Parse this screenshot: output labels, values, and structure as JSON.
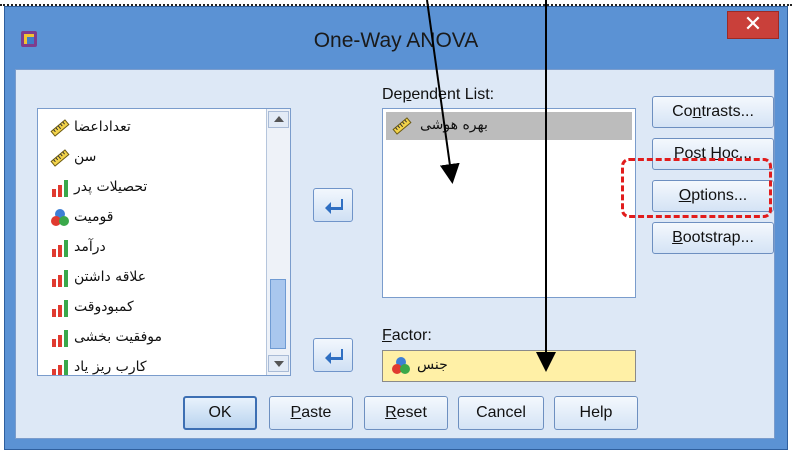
{
  "window": {
    "title": "One-Way ANOVA",
    "close_glyph": "✕",
    "icon": "spss-app-icon"
  },
  "source_list": {
    "items": [
      {
        "label": "تعداداعضا",
        "icon": "scale-ruler-icon"
      },
      {
        "label": "سن",
        "icon": "scale-ruler-icon"
      },
      {
        "label": "تحصیلات پدر",
        "icon": "ordinal-bar-icon"
      },
      {
        "label": "قومیت",
        "icon": "nominal-circles-icon"
      },
      {
        "label": "درآمد",
        "icon": "ordinal-bar-icon"
      },
      {
        "label": "علاقه داشتن",
        "icon": "ordinal-bar-icon"
      },
      {
        "label": "کمبودوقت",
        "icon": "ordinal-bar-icon"
      },
      {
        "label": "موفقیت بخشی",
        "icon": "ordinal-bar-icon"
      },
      {
        "label": "کارب ریز یاد",
        "icon": "ordinal-bar-icon"
      }
    ]
  },
  "dependent_list": {
    "label_pre": "De",
    "label_u": "p",
    "label_post": "endent List:",
    "items": [
      {
        "label": "بهره هوشی",
        "icon": "scale-ruler-icon"
      }
    ]
  },
  "factor": {
    "label_pre": "",
    "label_u": "F",
    "label_post": "actor:",
    "value": "جنس",
    "icon": "nominal-circles-icon"
  },
  "side_buttons": [
    {
      "pre": "Co",
      "u": "n",
      "post": "trasts..."
    },
    {
      "pre": "Post ",
      "u": "H",
      "post": "oc..."
    },
    {
      "pre": "",
      "u": "O",
      "post": "ptions..."
    },
    {
      "pre": "",
      "u": "B",
      "post": "ootstrap..."
    }
  ],
  "bottom_buttons": {
    "ok": "OK",
    "paste_u": "P",
    "paste_post": "aste",
    "reset_u": "R",
    "reset_post": "eset",
    "cancel": "Cancel",
    "help": "Help"
  },
  "colors": {
    "window_frame": "#5b92d4",
    "client_bg": "#dde8f6",
    "close_red": "#c9403a",
    "factor_bg": "#fff0a6",
    "highlight_red": "#e11c1c"
  }
}
